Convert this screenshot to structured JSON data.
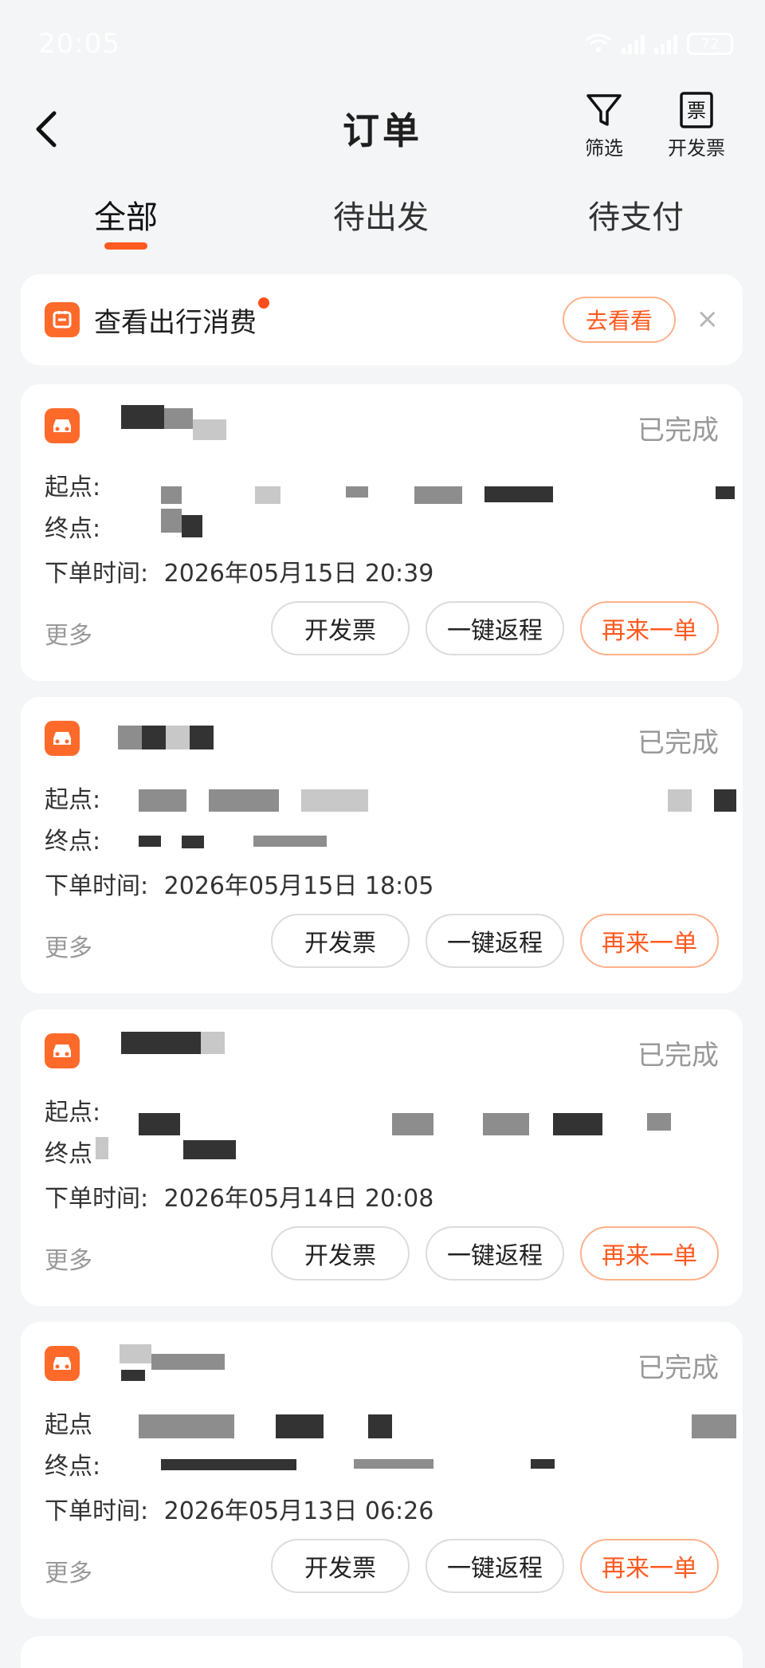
{
  "status_bar": {
    "time": "20:05",
    "battery": "72"
  },
  "nav": {
    "title": "订单",
    "filter_label": "筛选",
    "invoice_label": "开发票",
    "invoice_icon_char": "票"
  },
  "tabs": [
    {
      "label": "全部",
      "active": true
    },
    {
      "label": "待出发",
      "active": false
    },
    {
      "label": "待支付",
      "active": false
    }
  ],
  "promo": {
    "text": "查看出行消费",
    "button": "去看看",
    "close": "×"
  },
  "orders": [
    {
      "status": "已完成",
      "start_label": "起点:",
      "end_label": "终点:",
      "time_label": "下单时间:",
      "time": "2026年05月15日 20:39"
    },
    {
      "status": "已完成",
      "start_label": "起点:",
      "end_label": "终点:",
      "time_label": "下单时间:",
      "time": "2026年05月15日 18:05"
    },
    {
      "status": "已完成",
      "start_label": "起点:",
      "end_label": "终点",
      "time_label": "下单时间:",
      "time": "2026年05月14日 20:08"
    },
    {
      "status": "已完成",
      "start_label": "起点",
      "end_label": "终点:",
      "time_label": "下单时间:",
      "time": "2026年05月13日 06:26"
    }
  ],
  "order_actions": {
    "more": "更多",
    "invoice": "开发票",
    "return_trip": "一键返程",
    "again": "再来一单"
  },
  "colors": {
    "accent": "#ff5a1f",
    "background": "#f4f5f7",
    "card": "#ffffff"
  }
}
